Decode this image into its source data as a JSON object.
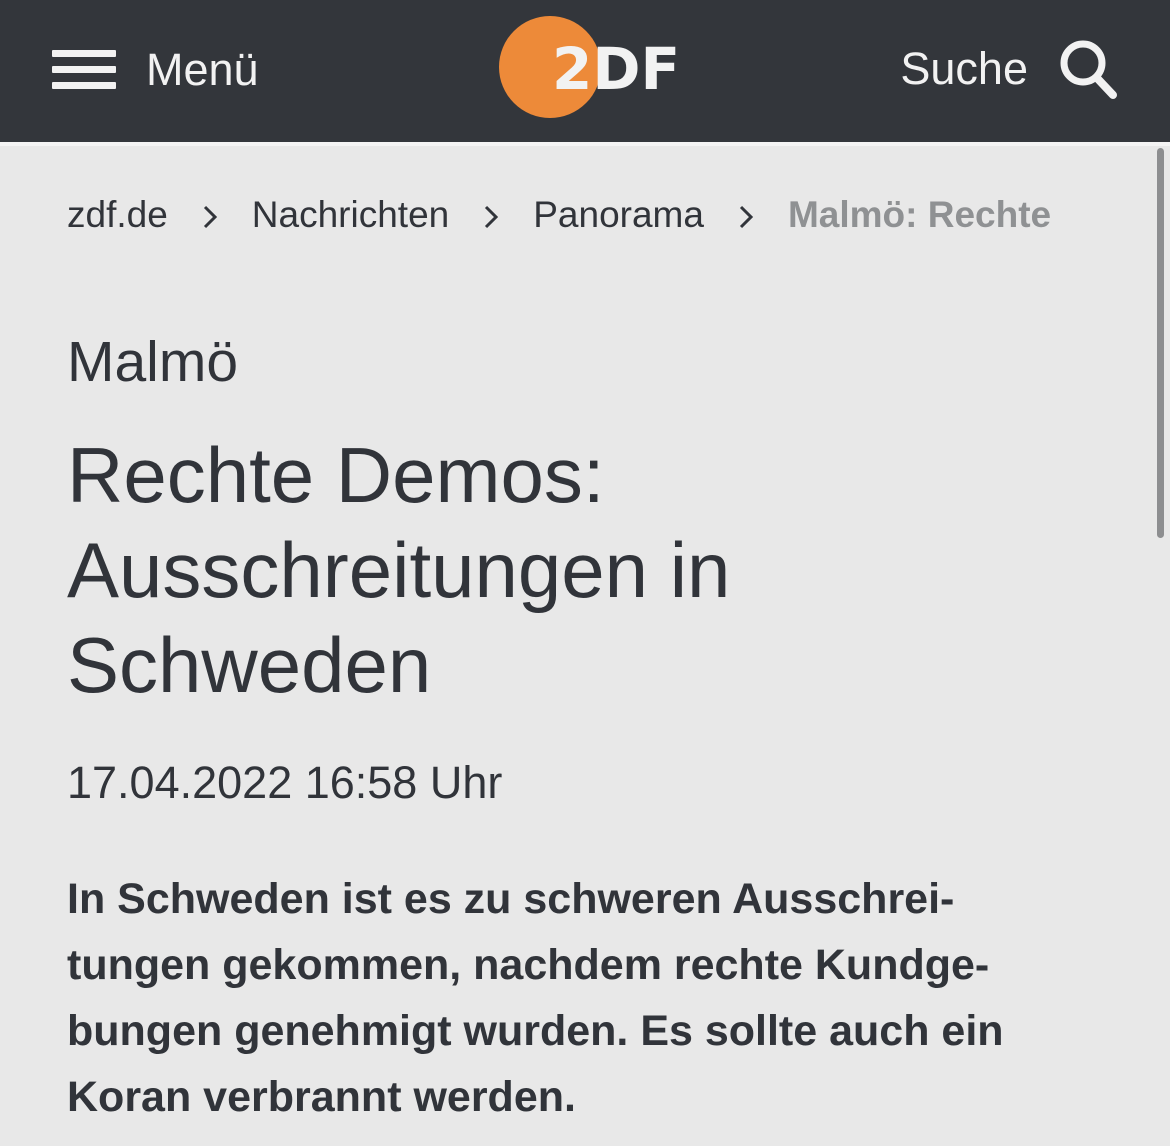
{
  "header": {
    "menu_label": "Menü",
    "logo_text": "2DF",
    "search_label": "Suche",
    "brand_color": "#ed8a39",
    "bar_color": "#33363b",
    "icons": {
      "menu": "hamburger-icon",
      "search": "search-icon"
    }
  },
  "breadcrumb": {
    "items": [
      "zdf.de",
      "Nachrichten",
      "Panorama"
    ],
    "current": "Malmö: Rechte",
    "separator_icon": "chevron-right-icon"
  },
  "article": {
    "kicker": "Malmö",
    "headline_lines": [
      "Rechte Demos:",
      "Ausschreitungen in",
      "Schweden"
    ],
    "timestamp": "17.04.2022 16:58 Uhr",
    "lead_lines": [
      "In Schweden ist es zu schweren Ausschrei-",
      "tungen gekommen, nachdem rechte Kundge-",
      "bungen genehmigt wurden. Es sollte auch ein",
      "Koran verbrannt werden."
    ]
  }
}
